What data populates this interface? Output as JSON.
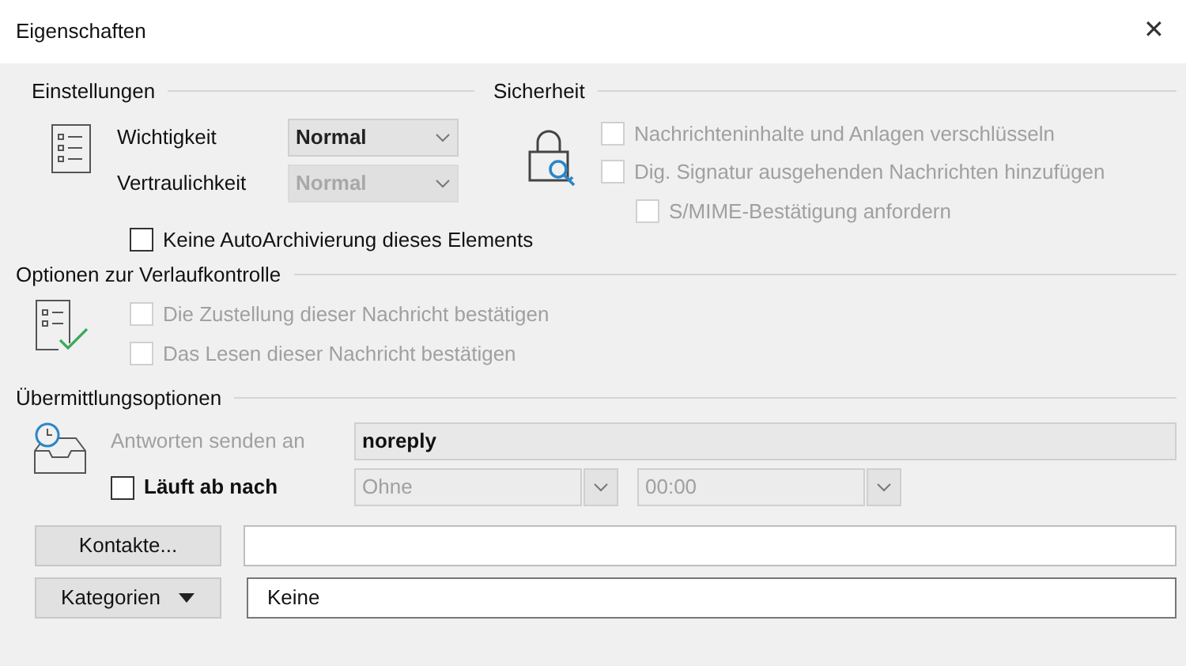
{
  "window": {
    "title": "Eigenschaften",
    "close": "✕"
  },
  "settings": {
    "heading": "Einstellungen",
    "fields": [
      {
        "label": "Wichtigkeit",
        "value": "Normal",
        "disabled": false
      },
      {
        "label": "Vertraulichkeit",
        "value": "Normal",
        "disabled": true
      }
    ],
    "autoarchive": {
      "label": "Keine AutoArchivierung dieses Elements",
      "checked": false,
      "disabled": false
    }
  },
  "security": {
    "heading": "Sicherheit",
    "options": [
      {
        "label": "Nachrichteninhalte und Anlagen verschlüsseln",
        "checked": false,
        "disabled": true
      },
      {
        "label": "Dig. Signatur ausgehenden Nachrichten hinzufügen",
        "checked": false,
        "disabled": true
      }
    ],
    "sub_option": {
      "label": "S/MIME-Bestätigung anfordern",
      "checked": false,
      "disabled": true
    }
  },
  "tracking": {
    "heading": "Optionen zur Verlaufkontrolle",
    "options": [
      {
        "label": "Die Zustellung dieser Nachricht bestätigen",
        "checked": false,
        "disabled": true
      },
      {
        "label": "Das Lesen dieser Nachricht bestätigen",
        "checked": false,
        "disabled": true
      }
    ]
  },
  "delivery": {
    "heading": "Übermittlungsoptionen",
    "reply_to": {
      "label": "Antworten senden an",
      "value": "noreply",
      "disabled": true
    },
    "expires": {
      "label": "Läuft ab nach",
      "checked": false,
      "date": "Ohne",
      "time": "00:00",
      "disabled": true
    }
  },
  "contacts": {
    "button": "Kontakte..."
  },
  "categories": {
    "button": "Kategorien",
    "value": "Keine"
  }
}
